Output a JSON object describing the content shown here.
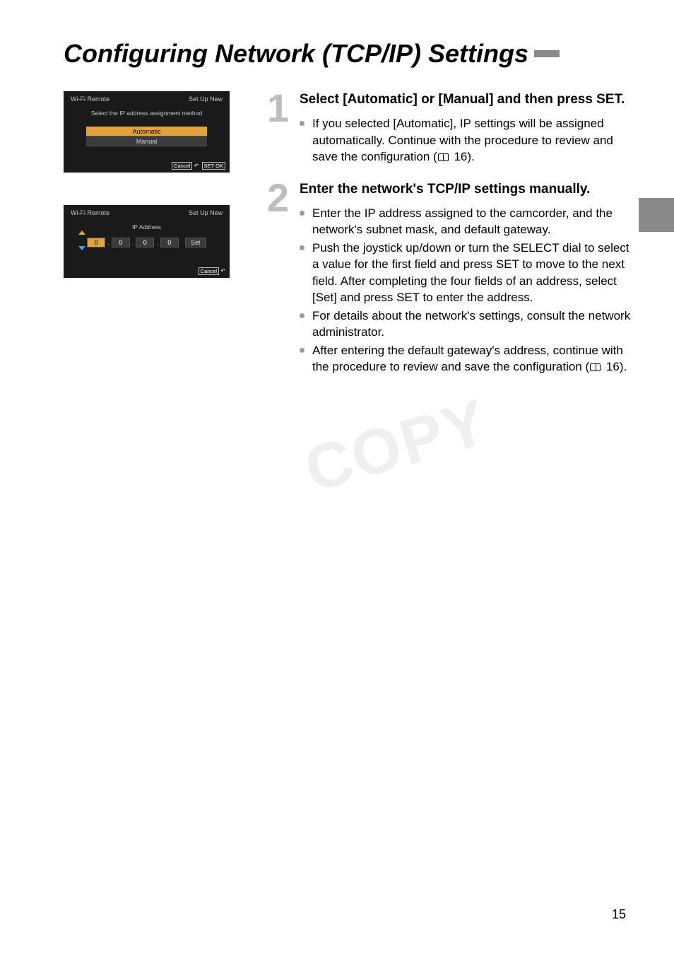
{
  "title": "Configuring Network (TCP/IP) Settings",
  "screen1": {
    "hdr_left": "Wi-Fi Remote",
    "hdr_right": "Set Up New",
    "subtitle": "Select the IP address assignment method",
    "opt_auto": "Automatic",
    "opt_manual": "Manual",
    "cancel": "Cancel",
    "back": "↶",
    "setok": "SET OK"
  },
  "screen2": {
    "hdr_left": "Wi-Fi Remote",
    "hdr_right": "Set Up New",
    "label": "IP Address",
    "f1": "0",
    "f2": "0",
    "f3": "0",
    "f4": "0",
    "set": "Set",
    "cancel": "Cancel",
    "back": "↶"
  },
  "step1": {
    "num": "1",
    "heading": "Select [Automatic] or [Manual] and then press SET.",
    "b1a": "If you selected [Automatic], IP settings will be assigned automatically. Continue with the procedure to review and save the configuration (",
    "b1b": " 16)."
  },
  "step2": {
    "num": "2",
    "heading": "Enter the network's TCP/IP settings manually.",
    "b1": "Enter the IP address assigned to the camcorder, and the network's subnet mask, and default gateway.",
    "b2": "Push the joystick up/down or turn the SELECT dial to select a value for the first field and press SET to move to the next field. After completing the four fields of an address, select [Set] and press SET to enter the address.",
    "b3": "For details about the network's settings, consult the network administrator.",
    "b4a": "After entering the default gateway's address, continue with the procedure to review and save the configuration (",
    "b4b": " 16)."
  },
  "watermark": "COPY",
  "page_number": "15"
}
